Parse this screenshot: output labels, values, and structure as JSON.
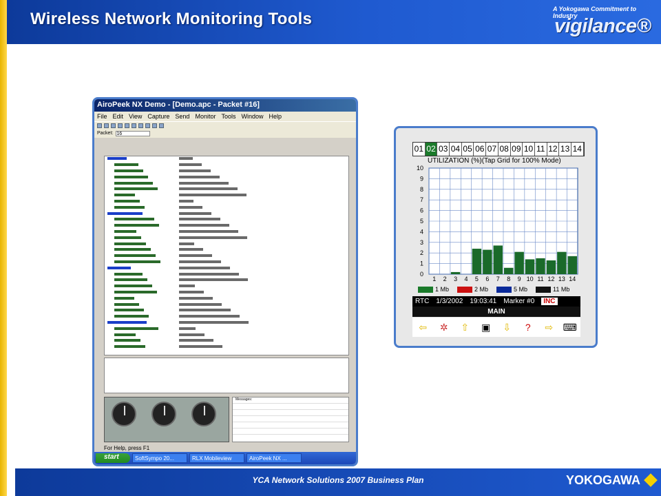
{
  "header": {
    "title": "Wireless Network Monitoring Tools",
    "tagline": "A Yokogawa Commitment to Industry",
    "brand": "vigilance®"
  },
  "footer": {
    "text": "YCA Network Solutions 2007 Business Plan",
    "logo": "YOKOGAWA"
  },
  "airopeek": {
    "title": "AiroPeek NX Demo - [Demo.apc - Packet #16]",
    "menu": [
      "File",
      "Edit",
      "View",
      "Capture",
      "Send",
      "Monitor",
      "Tools",
      "Window",
      "Help"
    ],
    "packet_label": "Packet:",
    "packet_value": "16",
    "status": "For Help, press F1",
    "taskbar": {
      "start": "start",
      "tasks": [
        "SoftSympo 20...",
        "RLX Mobileview",
        "AiroPeek NX ..."
      ]
    },
    "messages_label": "Messages:"
  },
  "channel_monitor": {
    "channels": [
      "01",
      "02",
      "03",
      "04",
      "05",
      "06",
      "07",
      "08",
      "09",
      "10",
      "11",
      "12",
      "13",
      "14"
    ],
    "selected": "02",
    "title": "UTILIZATION (%)(Tap Grid for 100% Mode)",
    "legend": [
      {
        "label": "1 Mb",
        "color": "#1a7a2a"
      },
      {
        "label": "2 Mb",
        "color": "#cc1111"
      },
      {
        "label": "5 Mb",
        "color": "#0a2a9a"
      },
      {
        "label": "11 Mb",
        "color": "#111111"
      }
    ],
    "rtc": "RTC",
    "date": "1/3/2002",
    "time": "19:03:41",
    "marker": "Marker #0",
    "inc": "INC",
    "main": "MAIN"
  },
  "chart_data": {
    "type": "bar",
    "categories": [
      "1",
      "2",
      "3",
      "4",
      "5",
      "6",
      "7",
      "8",
      "9",
      "10",
      "11",
      "12",
      "13",
      "14"
    ],
    "values": [
      0,
      0,
      0.2,
      0,
      2.4,
      2.3,
      2.7,
      0.6,
      2.1,
      1.4,
      1.5,
      1.3,
      2.1,
      1.7
    ],
    "xlabel": "",
    "ylabel": "",
    "ylim": [
      0,
      10
    ],
    "title": "UTILIZATION (%)(Tap Grid for 100% Mode)"
  }
}
